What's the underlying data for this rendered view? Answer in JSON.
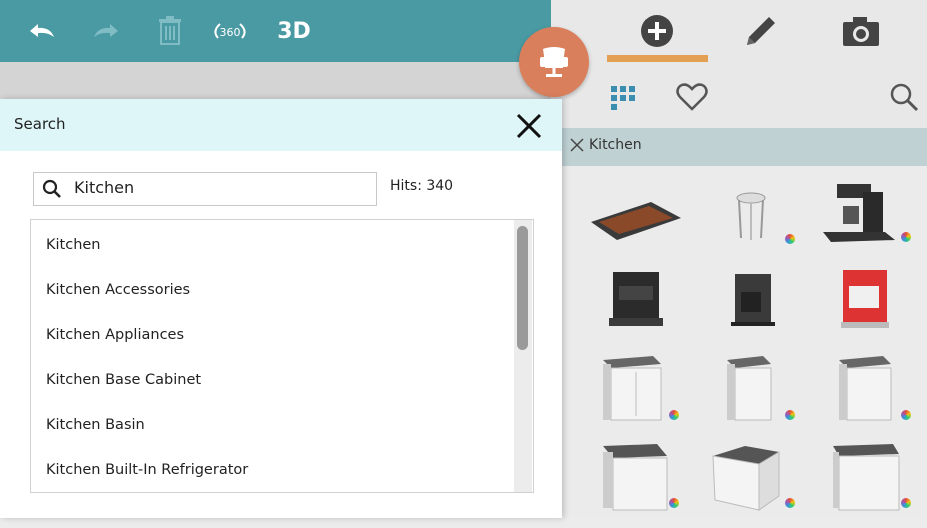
{
  "toolbar": {
    "label_3d": "3D",
    "label_360": "360"
  },
  "search_panel": {
    "title": "Search",
    "query": "Kitchen",
    "hits": "Hits: 340",
    "results": [
      "Kitchen",
      "Kitchen Accessories",
      "Kitchen Appliances",
      "Kitchen Base Cabinet",
      "Kitchen Basin",
      "Kitchen Built-In Refrigerator"
    ]
  },
  "filter": {
    "chip_label": "Kitchen"
  },
  "colors": {
    "topbar": "#4a9aa3",
    "accent_tab": "#e3a052",
    "chair_button": "#d97f5c",
    "panel_header": "#def6f8"
  }
}
